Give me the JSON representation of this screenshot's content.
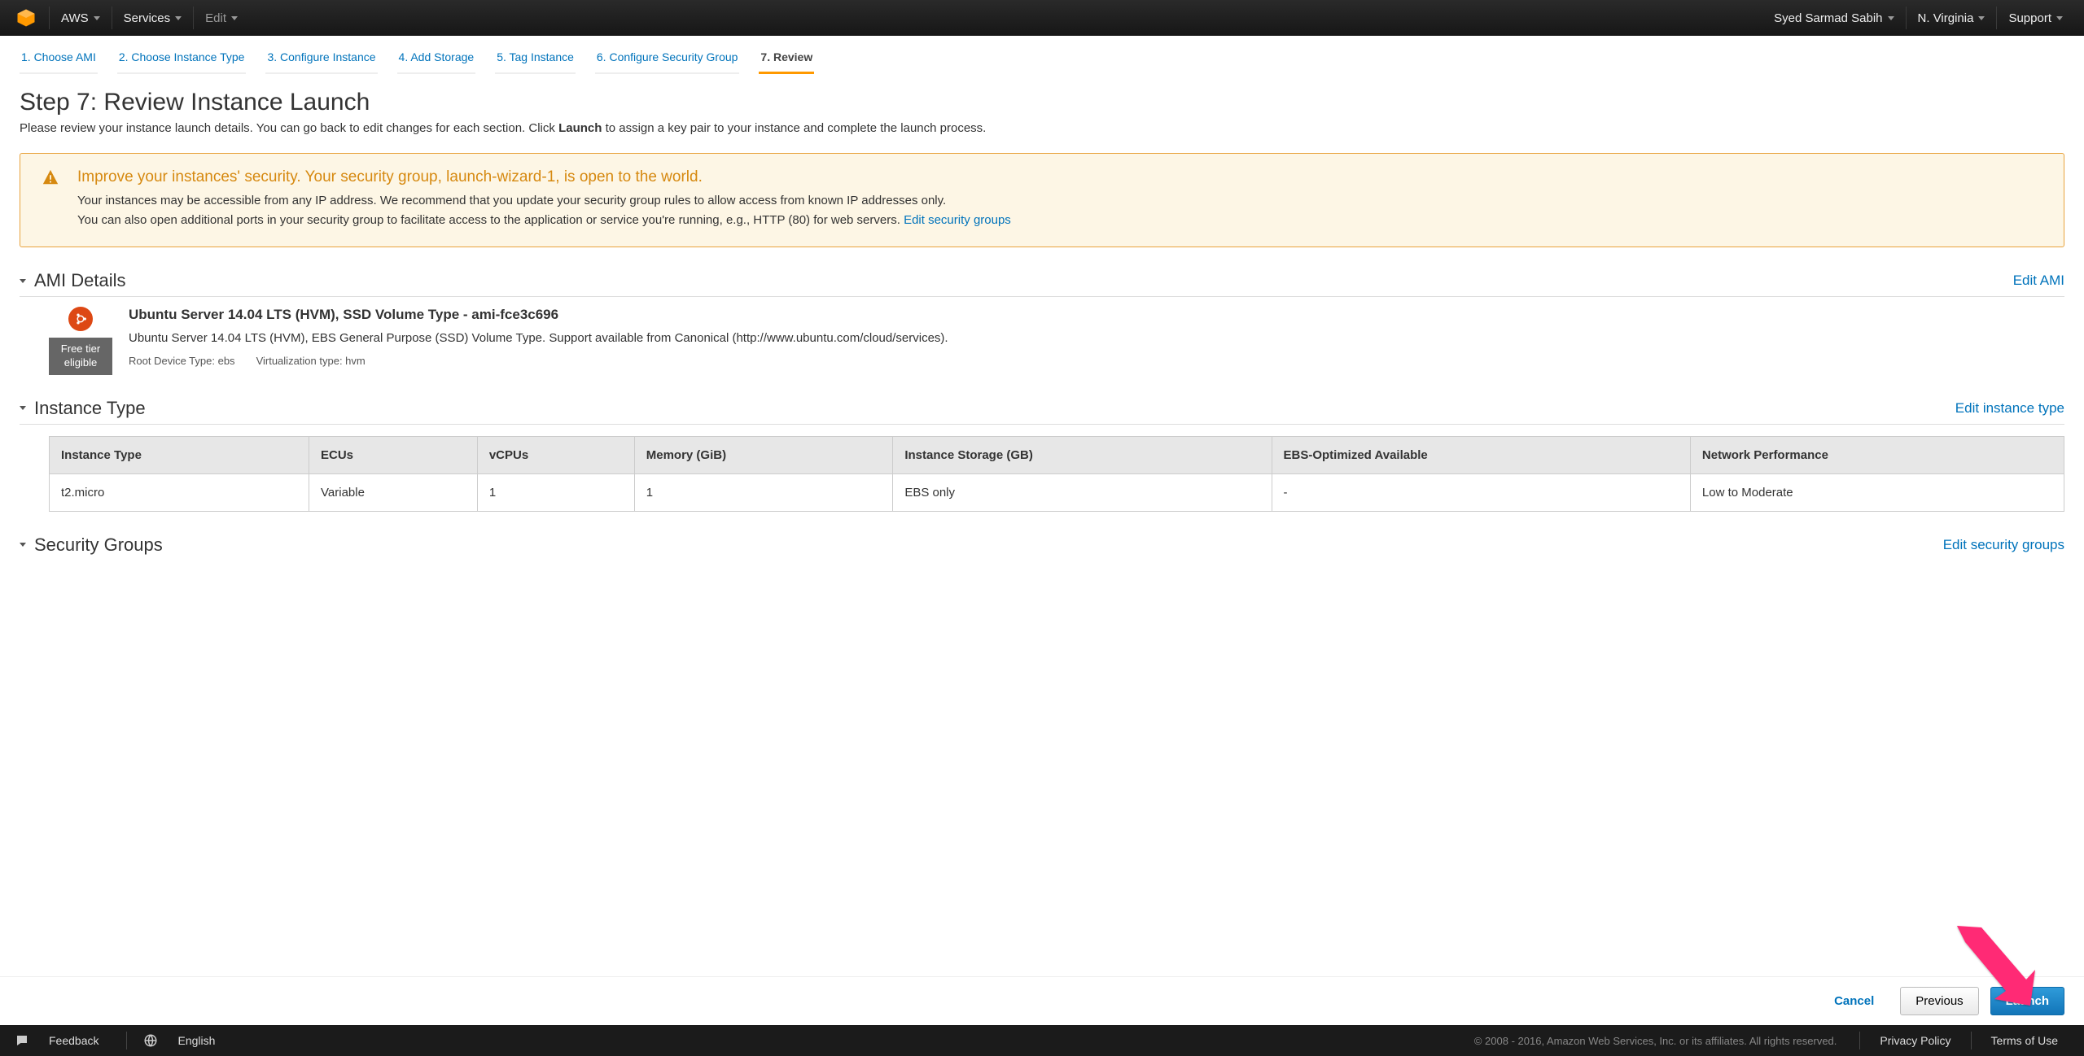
{
  "topnav": {
    "brand": "AWS",
    "services": "Services",
    "edit": "Edit",
    "user": "Syed Sarmad Sabih",
    "region": "N. Virginia",
    "support": "Support"
  },
  "wizard": {
    "steps": [
      "1. Choose AMI",
      "2. Choose Instance Type",
      "3. Configure Instance",
      "4. Add Storage",
      "5. Tag Instance",
      "6. Configure Security Group",
      "7. Review"
    ],
    "active_index": 6
  },
  "page": {
    "title": "Step 7: Review Instance Launch",
    "desc_pre": "Please review your instance launch details. You can go back to edit changes for each section. Click ",
    "desc_bold": "Launch",
    "desc_post": " to assign a key pair to your instance and complete the launch process."
  },
  "alert": {
    "heading": "Improve your instances' security. Your security group, launch-wizard-1, is open to the world.",
    "line1": "Your instances may be accessible from any IP address. We recommend that you update your security group rules to allow access from known IP addresses only.",
    "line2": "You can also open additional ports in your security group to facilitate access to the application or service you're running, e.g., HTTP (80) for web servers. ",
    "link": "Edit security groups"
  },
  "ami": {
    "section_title": "AMI Details",
    "edit_link": "Edit AMI",
    "free_tier": "Free tier eligible",
    "title": "Ubuntu Server 14.04 LTS (HVM), SSD Volume Type - ami-fce3c696",
    "desc": "Ubuntu Server 14.04 LTS (HVM), EBS General Purpose (SSD) Volume Type. Support available from Canonical (http://www.ubuntu.com/cloud/services).",
    "root_device": "Root Device Type: ebs",
    "virt": "Virtualization type: hvm"
  },
  "instance_type": {
    "section_title": "Instance Type",
    "edit_link": "Edit instance type",
    "headers": [
      "Instance Type",
      "ECUs",
      "vCPUs",
      "Memory (GiB)",
      "Instance Storage (GB)",
      "EBS-Optimized Available",
      "Network Performance"
    ],
    "row": [
      "t2.micro",
      "Variable",
      "1",
      "1",
      "EBS only",
      "-",
      "Low to Moderate"
    ]
  },
  "security_groups": {
    "section_title": "Security Groups",
    "edit_link": "Edit security groups"
  },
  "actions": {
    "cancel": "Cancel",
    "previous": "Previous",
    "launch": "Launch"
  },
  "footer": {
    "feedback": "Feedback",
    "language": "English",
    "copyright": "© 2008 - 2016, Amazon Web Services, Inc. or its affiliates. All rights reserved.",
    "privacy": "Privacy Policy",
    "terms": "Terms of Use"
  }
}
